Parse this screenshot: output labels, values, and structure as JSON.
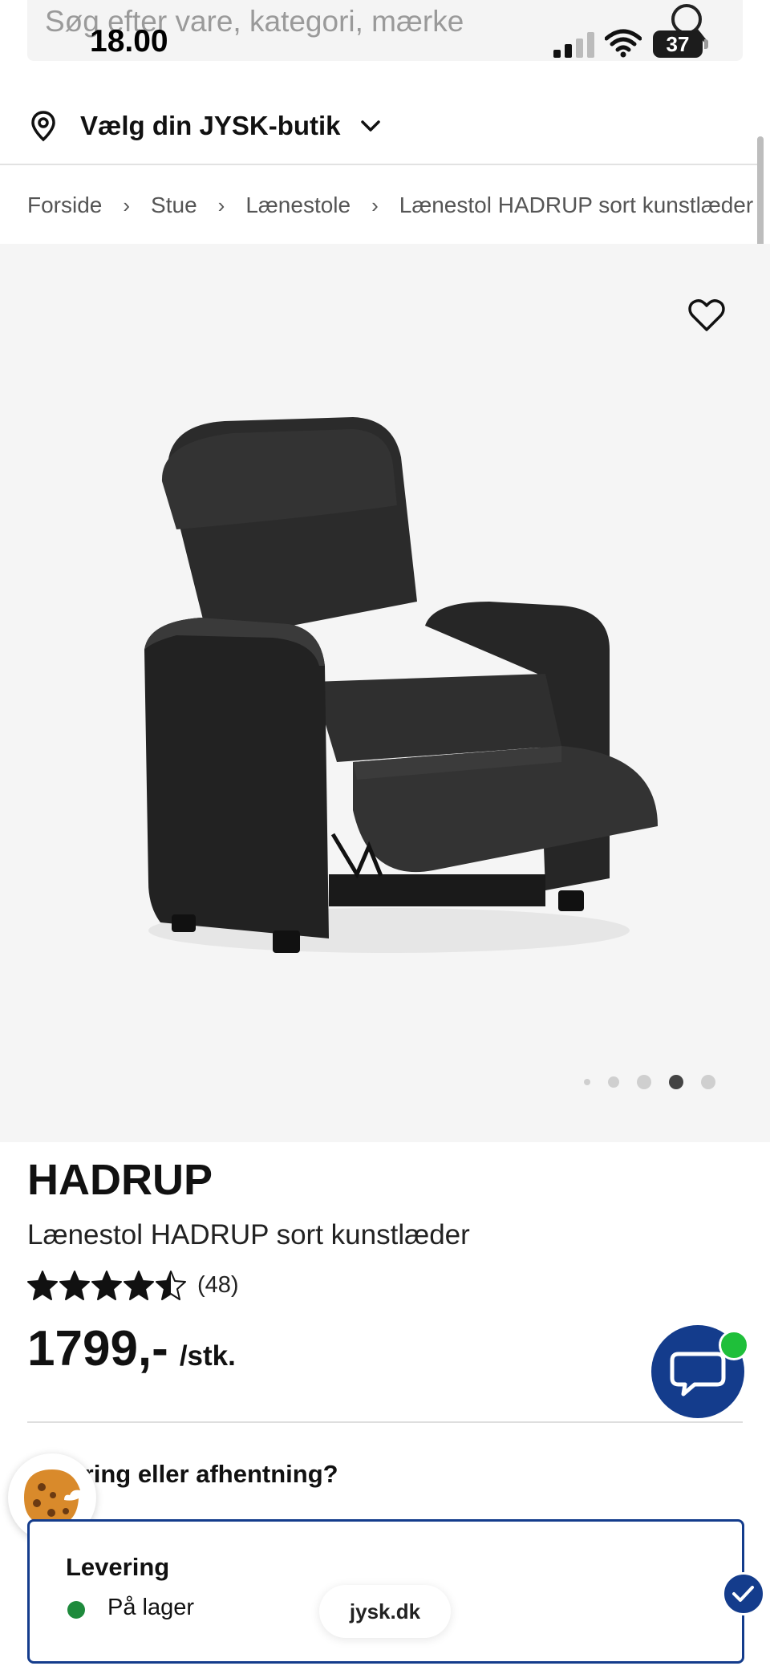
{
  "status_bar": {
    "time": "18.00",
    "battery": "37"
  },
  "search": {
    "placeholder": "Søg efter vare, kategori, mærke"
  },
  "store": {
    "label": "Vælg din JYSK-butik"
  },
  "breadcrumb": {
    "items": [
      "Forside",
      "Stue",
      "Lænestole",
      "Lænestol HADRUP sort kunstlæder"
    ],
    "separator": "›"
  },
  "gallery": {
    "image_count": 5,
    "active_index": 3
  },
  "product": {
    "brand": "HADRUP",
    "name": "Lænestol HADRUP sort kunstlæder",
    "rating": 4.5,
    "review_count": "(48)",
    "price": "1799,-",
    "unit": "/stk."
  },
  "delivery": {
    "heading": "Levering eller afhentning?",
    "option_title": "Levering",
    "stock_status": "På lager"
  },
  "browser": {
    "url": "jysk.dk"
  },
  "colors": {
    "brand_blue": "#143c8c",
    "stock_green": "#1e8a3c",
    "online_green": "#1fbf3a"
  }
}
